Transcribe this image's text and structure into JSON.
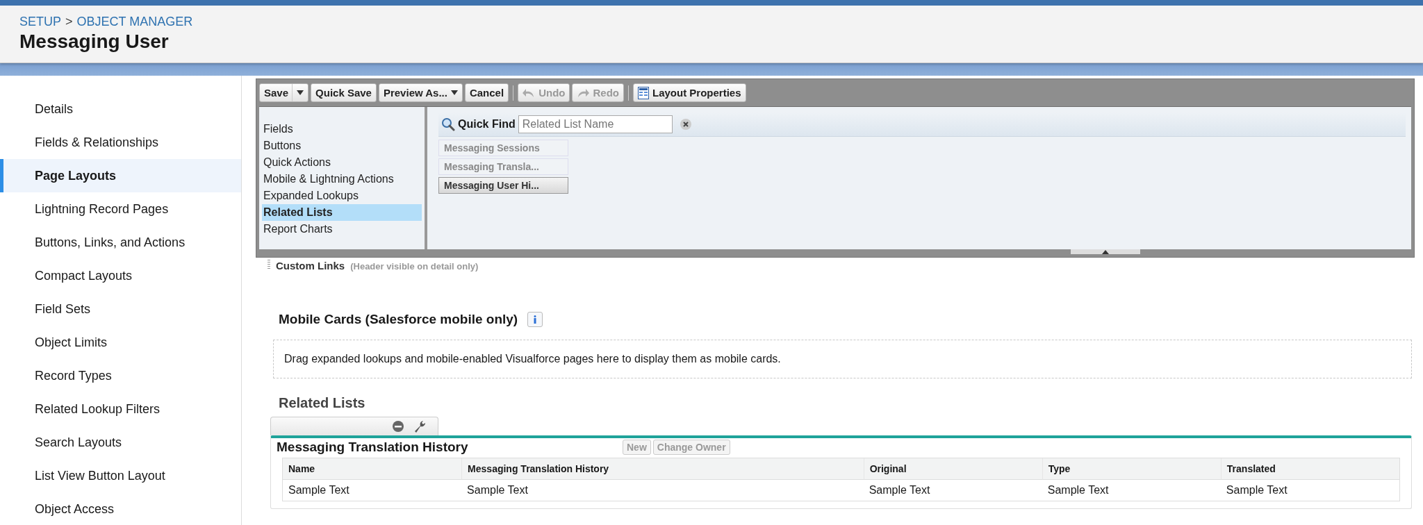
{
  "breadcrumb": {
    "items": [
      "SETUP",
      "OBJECT MANAGER"
    ],
    "separator": ">"
  },
  "title": "Messaging User",
  "sidebar": {
    "items": [
      {
        "label": "Details",
        "selected": false
      },
      {
        "label": "Fields & Relationships",
        "selected": false
      },
      {
        "label": "Page Layouts",
        "selected": true
      },
      {
        "label": "Lightning Record Pages",
        "selected": false
      },
      {
        "label": "Buttons, Links, and Actions",
        "selected": false
      },
      {
        "label": "Compact Layouts",
        "selected": false
      },
      {
        "label": "Field Sets",
        "selected": false
      },
      {
        "label": "Object Limits",
        "selected": false
      },
      {
        "label": "Record Types",
        "selected": false
      },
      {
        "label": "Related Lookup Filters",
        "selected": false
      },
      {
        "label": "Search Layouts",
        "selected": false
      },
      {
        "label": "List View Button Layout",
        "selected": false
      },
      {
        "label": "Object Access",
        "selected": false
      }
    ]
  },
  "toolbar": {
    "buttons": [
      {
        "label": "Save",
        "kind": "split",
        "disabled": false
      },
      {
        "label": "Quick Save",
        "kind": "plain",
        "disabled": false
      },
      {
        "label": "Preview As...",
        "kind": "dropdown",
        "disabled": false
      },
      {
        "label": "Cancel",
        "kind": "plain",
        "disabled": false
      },
      {
        "label": "Undo",
        "kind": "undo",
        "disabled": true
      },
      {
        "label": "Redo",
        "kind": "redo",
        "disabled": true
      },
      {
        "label": "Layout Properties",
        "kind": "properties",
        "disabled": false
      }
    ]
  },
  "palette": {
    "categories": [
      {
        "label": "Fields",
        "selected": false
      },
      {
        "label": "Buttons",
        "selected": false
      },
      {
        "label": "Quick Actions",
        "selected": false
      },
      {
        "label": "Mobile & Lightning Actions",
        "selected": false
      },
      {
        "label": "Expanded Lookups",
        "selected": false
      },
      {
        "label": "Related Lists",
        "selected": true
      },
      {
        "label": "Report Charts",
        "selected": false
      }
    ],
    "quick_find": {
      "label": "Quick Find",
      "placeholder": "Related List Name"
    },
    "items": [
      {
        "label": "Messaging Sessions",
        "used": true
      },
      {
        "label": "Messaging Transla...",
        "used": true
      },
      {
        "label": "Messaging User Hi...",
        "used": false
      }
    ]
  },
  "custom_links": {
    "title": "Custom Links",
    "note": "(Header visible on detail only)"
  },
  "mobile_cards": {
    "title": "Mobile Cards (Salesforce mobile only)",
    "hint": "Drag expanded lookups and mobile-enabled Visualforce pages here to display them as mobile cards."
  },
  "related_lists": {
    "title": "Related Lists",
    "list": {
      "title": "Messaging Translation History",
      "buttons": [
        "New",
        "Change Owner"
      ],
      "columns": [
        "Name",
        "Messaging Translation History",
        "Original",
        "Type",
        "Translated"
      ],
      "rows": [
        [
          "Sample Text",
          "Sample Text",
          "Sample Text",
          "Sample Text",
          "Sample Text"
        ]
      ]
    }
  }
}
